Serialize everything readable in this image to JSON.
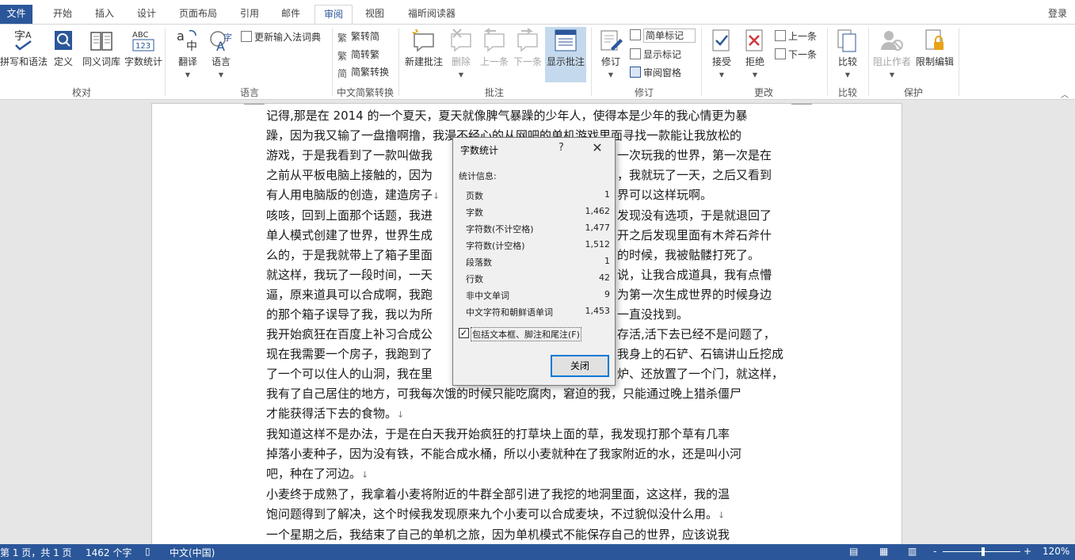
{
  "tabs": [
    "文件",
    "开始",
    "插入",
    "设计",
    "页面布局",
    "引用",
    "邮件",
    "审阅",
    "视图",
    "福昕阅读器"
  ],
  "active_tab": "审阅",
  "signin": "登录",
  "ribbon": {
    "groups": {
      "proofing": "校对",
      "language": "语言",
      "chinese_conversion": "中文简繁转换",
      "comments": "批注",
      "tracking": "修订",
      "changes": "更改",
      "compare": "比较",
      "protect": "保护"
    },
    "buttons": {
      "spelling": "拼写和语法",
      "define": "定义",
      "thesaurus": "同义词库",
      "word_count": "字数统计",
      "translate": "翻译",
      "language": "语言",
      "update_ime": "更新输入法词典",
      "to_traditional": "繁转简",
      "to_simplified": "简转繁",
      "conversion": "简繁转换",
      "new_comment": "新建批注",
      "delete": "删除",
      "previous": "上一条",
      "next": "下一条",
      "show_comments": "显示批注",
      "track_changes": "修订",
      "simple_markup": "简单标记",
      "show_markup": "显示标记",
      "review_pane": "审阅窗格",
      "accept": "接受",
      "reject": "拒绝",
      "prev_change": "上一条",
      "next_change": "下一条",
      "compare": "比较",
      "block_authors": "阻止作者",
      "restrict_editing": "限制编辑"
    }
  },
  "document": {
    "lines": [
      "记得,那是在 2014 的一个夏天，夏天就像脾气暴躁的少年人，使得本是少年的我心情更为暴",
      "躁，因为我又输了一盘撸啊撸，我漫不经心的从网吧的单机游戏里面寻找一款能让我放松的",
      "游戏，于是我看到了一款叫做我",
      "之前从平板电脑上接触的，因为",
      "有人用电脑版的创造，建造房子",
      " 咳咳，回到上面那个话题，我进",
      "单人模式创建了世界，世界生成",
      "么的，于是我就带上了箱子里面",
      " 就这样，我玩了一段时间，一天",
      "逼，原来道具可以合成啊，我跑",
      "的那个箱子误导了我，我以为所",
      " 我开始疯狂在百度上补习合成公",
      "现在我需要一个房子，我跑到了",
      "了一个可以住人的山洞，我在里",
      "我有了自己居住的地方，可我每次饿的时候只能吃腐肉，窘迫的我，只能通过晚上猎杀僵尸",
      "才能获得活下去的食物。",
      " 我知道这样不是办法，于是在白天我开始疯狂的打草块上面的草，我发现打那个草有几率",
      "掉落小麦种子，因为没有铁，不能合成水桶，所以小麦就种在了我家附近的水，还是叫小河",
      "吧，种在了河边。",
      " 小麦终于成熟了，我拿着小麦将附近的牛群全部引进了我挖的地洞里面，这这样，我的温",
      "饱问题得到了解决，这个时候我发现原来九个小麦可以合成麦块，不过貌似没什么用。",
      " 一个星期之后，我结束了自己的单机之旅，因为单机模式不能保存自己的世界，应该说我"
    ],
    "right_fragments": [
      "一次玩我的世界，第一次是在",
      "，我就玩了一天，之后又看到",
      "界可以这样玩啊。",
      "发现没有选项，于是就退回了",
      "开之后发现里面有木斧石斧什",
      "的时候，我被骷髅打死了。",
      "说，让我合成道具，我有点懵",
      "为第一次生成世界的时候身边",
      "一直没找到。",
      "存活,活下去已经不是问题了，",
      "我身上的石铲、石镐讲山丘挖成",
      "炉、还放置了一个门，就这样，"
    ]
  },
  "dialog": {
    "title": "字数统计",
    "help": "?",
    "close_x": "✕",
    "stats_label": "统计信息:",
    "stats": [
      {
        "label": "页数",
        "value": "1"
      },
      {
        "label": "字数",
        "value": "1,462"
      },
      {
        "label": "字符数(不计空格)",
        "value": "1,477"
      },
      {
        "label": "字符数(计空格)",
        "value": "1,512"
      },
      {
        "label": "段落数",
        "value": "1"
      },
      {
        "label": "行数",
        "value": "42"
      },
      {
        "label": "非中文单词",
        "value": "9"
      },
      {
        "label": "中文字符和朝鲜语单词",
        "value": "1,453"
      }
    ],
    "include_textboxes": "包括文本框、脚注和尾注(F)",
    "include_checked": true,
    "close_button": "关闭"
  },
  "status": {
    "page": "第 1 页，共 1 页",
    "words": "1462 个字",
    "language": "中文(中国)",
    "zoom": "120%",
    "zoom_minus": "-",
    "zoom_plus": "+"
  },
  "colors": {
    "accent": "#2b579a"
  }
}
